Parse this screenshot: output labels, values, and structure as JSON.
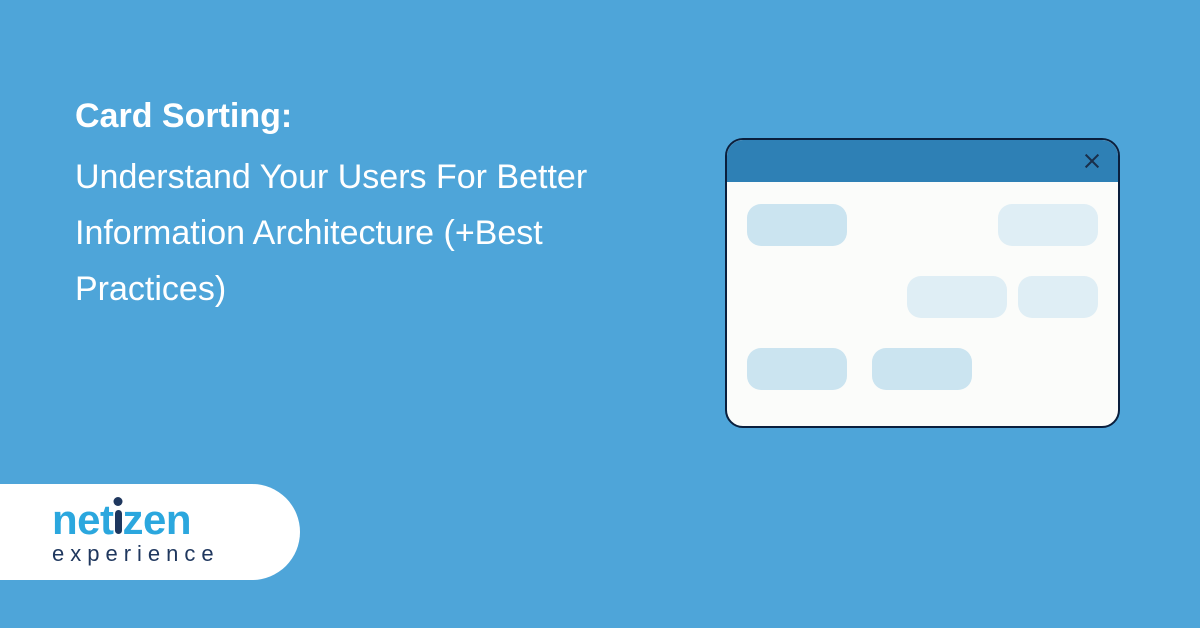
{
  "heading": {
    "title": "Card Sorting:",
    "subtitle": "Understand Your Users For Better Information Architecture (+Best Practices)"
  },
  "logo": {
    "part1": "net",
    "part2": "zen",
    "sub": "experience"
  }
}
